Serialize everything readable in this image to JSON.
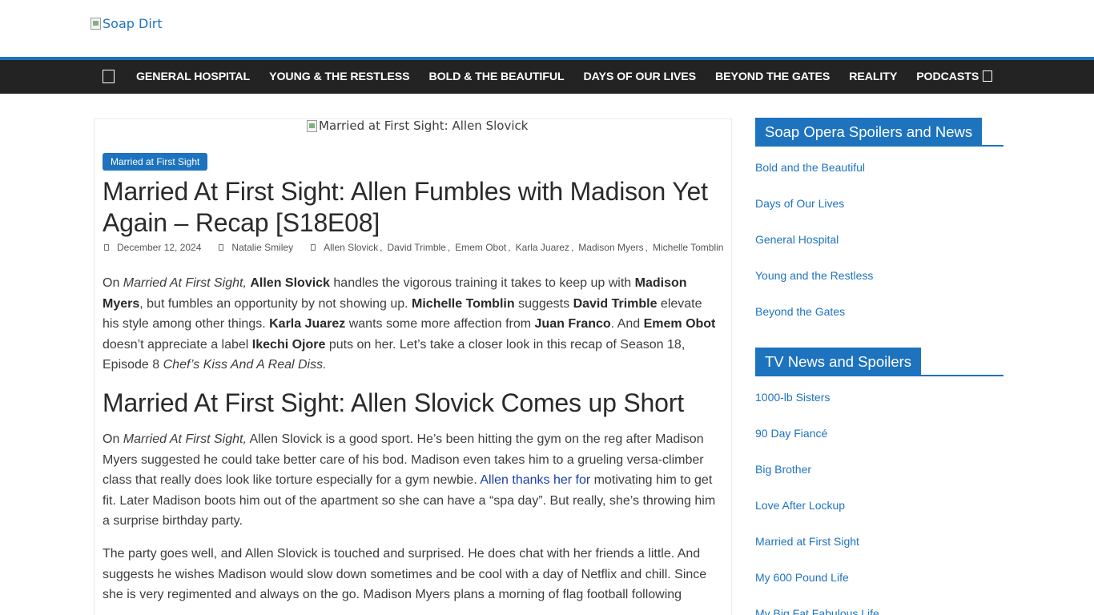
{
  "header": {
    "logo_alt": "Soap Dirt"
  },
  "nav": {
    "items": [
      {
        "label": "GENERAL HOSPITAL"
      },
      {
        "label": "YOUNG & THE RESTLESS"
      },
      {
        "label": "BOLD & THE BEAUTIFUL"
      },
      {
        "label": "DAYS OF OUR LIVES"
      },
      {
        "label": "BEYOND THE GATES"
      },
      {
        "label": "REALITY"
      },
      {
        "label": "PODCASTS"
      }
    ]
  },
  "article": {
    "featured_alt": "Married at First Sight: Allen Slovick",
    "category": "Married at First Sight",
    "title": "Married At First Sight: Allen Fumbles with Madison Yet Again – Recap [S18E08]",
    "date": "December 12, 2024",
    "author": "Natalie Smiley",
    "tags": [
      "Allen Slovick",
      "David Trimble",
      "Emem Obot",
      "Karla Juarez",
      "Madison Myers",
      "Michelle Tomblin"
    ],
    "p1": {
      "t1": "On ",
      "show": "Married At First Sight,",
      "t2": " ",
      "n1": "Allen Slovick",
      "t3": " handles the vigorous training it takes to keep up with ",
      "n2": "Madison Myers",
      "t4": ", but fumbles an opportunity by not showing up. ",
      "n3": "Michelle Tomblin",
      "t5": " suggests ",
      "n4": "David Trimble",
      "t6": " elevate his style among other things. ",
      "n5": "Karla Juarez",
      "t7": " wants some more affection from ",
      "n6": "Juan Franco",
      "t8": ". And ",
      "n7": "Emem Obot",
      "t9": " doesn’t appreciate a label ",
      "n8": "Ikechi Ojore",
      "t10": " puts on her. Let’s take a closer look in this recap of Season 18, Episode 8 ",
      "ep": "Chef’s Kiss And A Real Diss."
    },
    "h2": "Married At First Sight: Allen Slovick Comes up Short",
    "p2": {
      "t1": "On ",
      "show": "Married At First Sight,",
      "t2": " Allen Slovick is a good sport. He’s been hitting the gym on the reg after Madison Myers suggested he could take better care of his bod. Madison even takes him to a grueling versa-climber class that really does look like torture especially for a gym newbie. ",
      "link": "Allen thanks her for",
      "t3": " motivating him to get fit. Later Madison boots him out of the apartment so she can have a “spa day”. But really, she’s throwing him a surprise birthday party."
    },
    "p3": "The party goes well, and Allen Slovick is touched and surprised. He does chat with her friends a little. And suggests he wishes Madison would slow down sometimes and be cool with a day of Netflix and chill. Since she is very regimented and always on the go. Madison Myers plans a morning of flag football following"
  },
  "sidebar": {
    "widget1": {
      "title": "Soap Opera Spoilers and News",
      "links": [
        "Bold and the Beautiful",
        "Days of Our Lives",
        "General Hospital",
        "Young and the Restless",
        "Beyond the Gates"
      ]
    },
    "widget2": {
      "title": "TV News and Spoilers",
      "links": [
        "1000-lb Sisters",
        "90 Day Fiancé",
        "Big Brother",
        "Love After Lockup",
        "Married at First Sight",
        "My 600 Pound Life",
        "My Big Fat Fabulous Life"
      ]
    }
  },
  "colors": {
    "accent": "#1e73be",
    "nav_bg": "#232323"
  }
}
